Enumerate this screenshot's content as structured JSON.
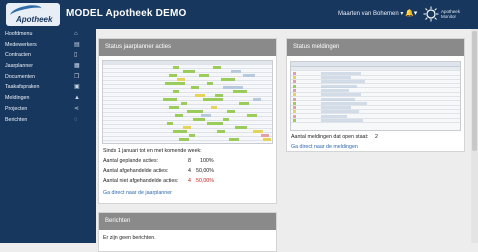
{
  "app": {
    "logo_text": "Apotheek",
    "title": "MODEL Apotheek DEMO"
  },
  "header": {
    "user": "Maarten van Bohemen ▾",
    "bell": "🔔▾",
    "monitor_line1": "Apotheek",
    "monitor_line2": "Monitor"
  },
  "sidebar": {
    "items": [
      {
        "label": "Hoofdmenu",
        "icon": "home-icon",
        "glyph": "⌂"
      },
      {
        "label": "Medewerkers",
        "icon": "id-card-icon",
        "glyph": "▤"
      },
      {
        "label": "Contracten",
        "icon": "document-icon",
        "glyph": "▯"
      },
      {
        "label": "Jaarplanner",
        "icon": "calendar-icon",
        "glyph": "▦"
      },
      {
        "label": "Documenten",
        "icon": "copy-icon",
        "glyph": "❐"
      },
      {
        "label": "Taakafspraken",
        "icon": "calendar-check-icon",
        "glyph": "▣"
      },
      {
        "label": "Meldingen",
        "icon": "warning-icon",
        "glyph": "▲"
      },
      {
        "label": "Projecten",
        "icon": "share-icon",
        "glyph": "⋖"
      },
      {
        "label": "Berichten",
        "icon": "chat-icon",
        "glyph": "◌"
      }
    ]
  },
  "planner": {
    "title": "Status jaarplanner acties",
    "since": "Sinds 1 januari tot en met komende week:",
    "rows": [
      {
        "label": "Aantal geplande acties:",
        "count": "8",
        "pct": "100%"
      },
      {
        "label": "Aantal afgehandelde acties:",
        "count": "4",
        "pct": "50,00%"
      },
      {
        "label": "Aantal niet afgehandelde acties:",
        "count": "4",
        "pct": "50,00%"
      }
    ],
    "link": "Ga direct naar de jaarplanner"
  },
  "meldingen": {
    "title": "Status meldingen",
    "open_label": "Aantal meldingen dat open staat:",
    "open_count": "2",
    "link": "Ga direct naar de meldingen"
  },
  "berichten": {
    "title": "Berichten",
    "empty": "Er zijn geen berichten."
  }
}
